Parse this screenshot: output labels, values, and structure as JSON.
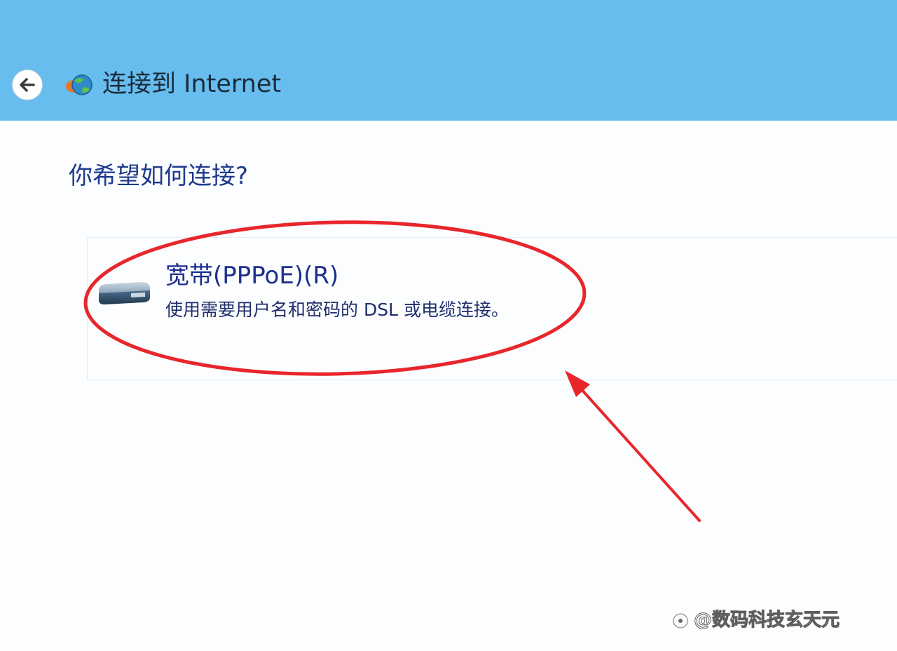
{
  "window": {
    "title": "连接到 Internet",
    "back_icon": "back-arrow-icon",
    "app_icon": "network-globe-icon"
  },
  "main": {
    "question": "你希望如何连接?",
    "options": [
      {
        "title": "宽带(PPPoE)(R)",
        "description": "使用需要用户名和密码的 DSL 或电缆连接。",
        "icon": "broadband-modem-icon"
      }
    ]
  },
  "annotation": {
    "shapes": [
      "ellipse",
      "arrow"
    ],
    "color": "#e8262c"
  },
  "watermark": {
    "text": "@数码科技玄天元"
  },
  "colors": {
    "titlebar": "#67bdee",
    "question_text": "#1d3a8e",
    "option_title_text": "#1d2f8e"
  }
}
